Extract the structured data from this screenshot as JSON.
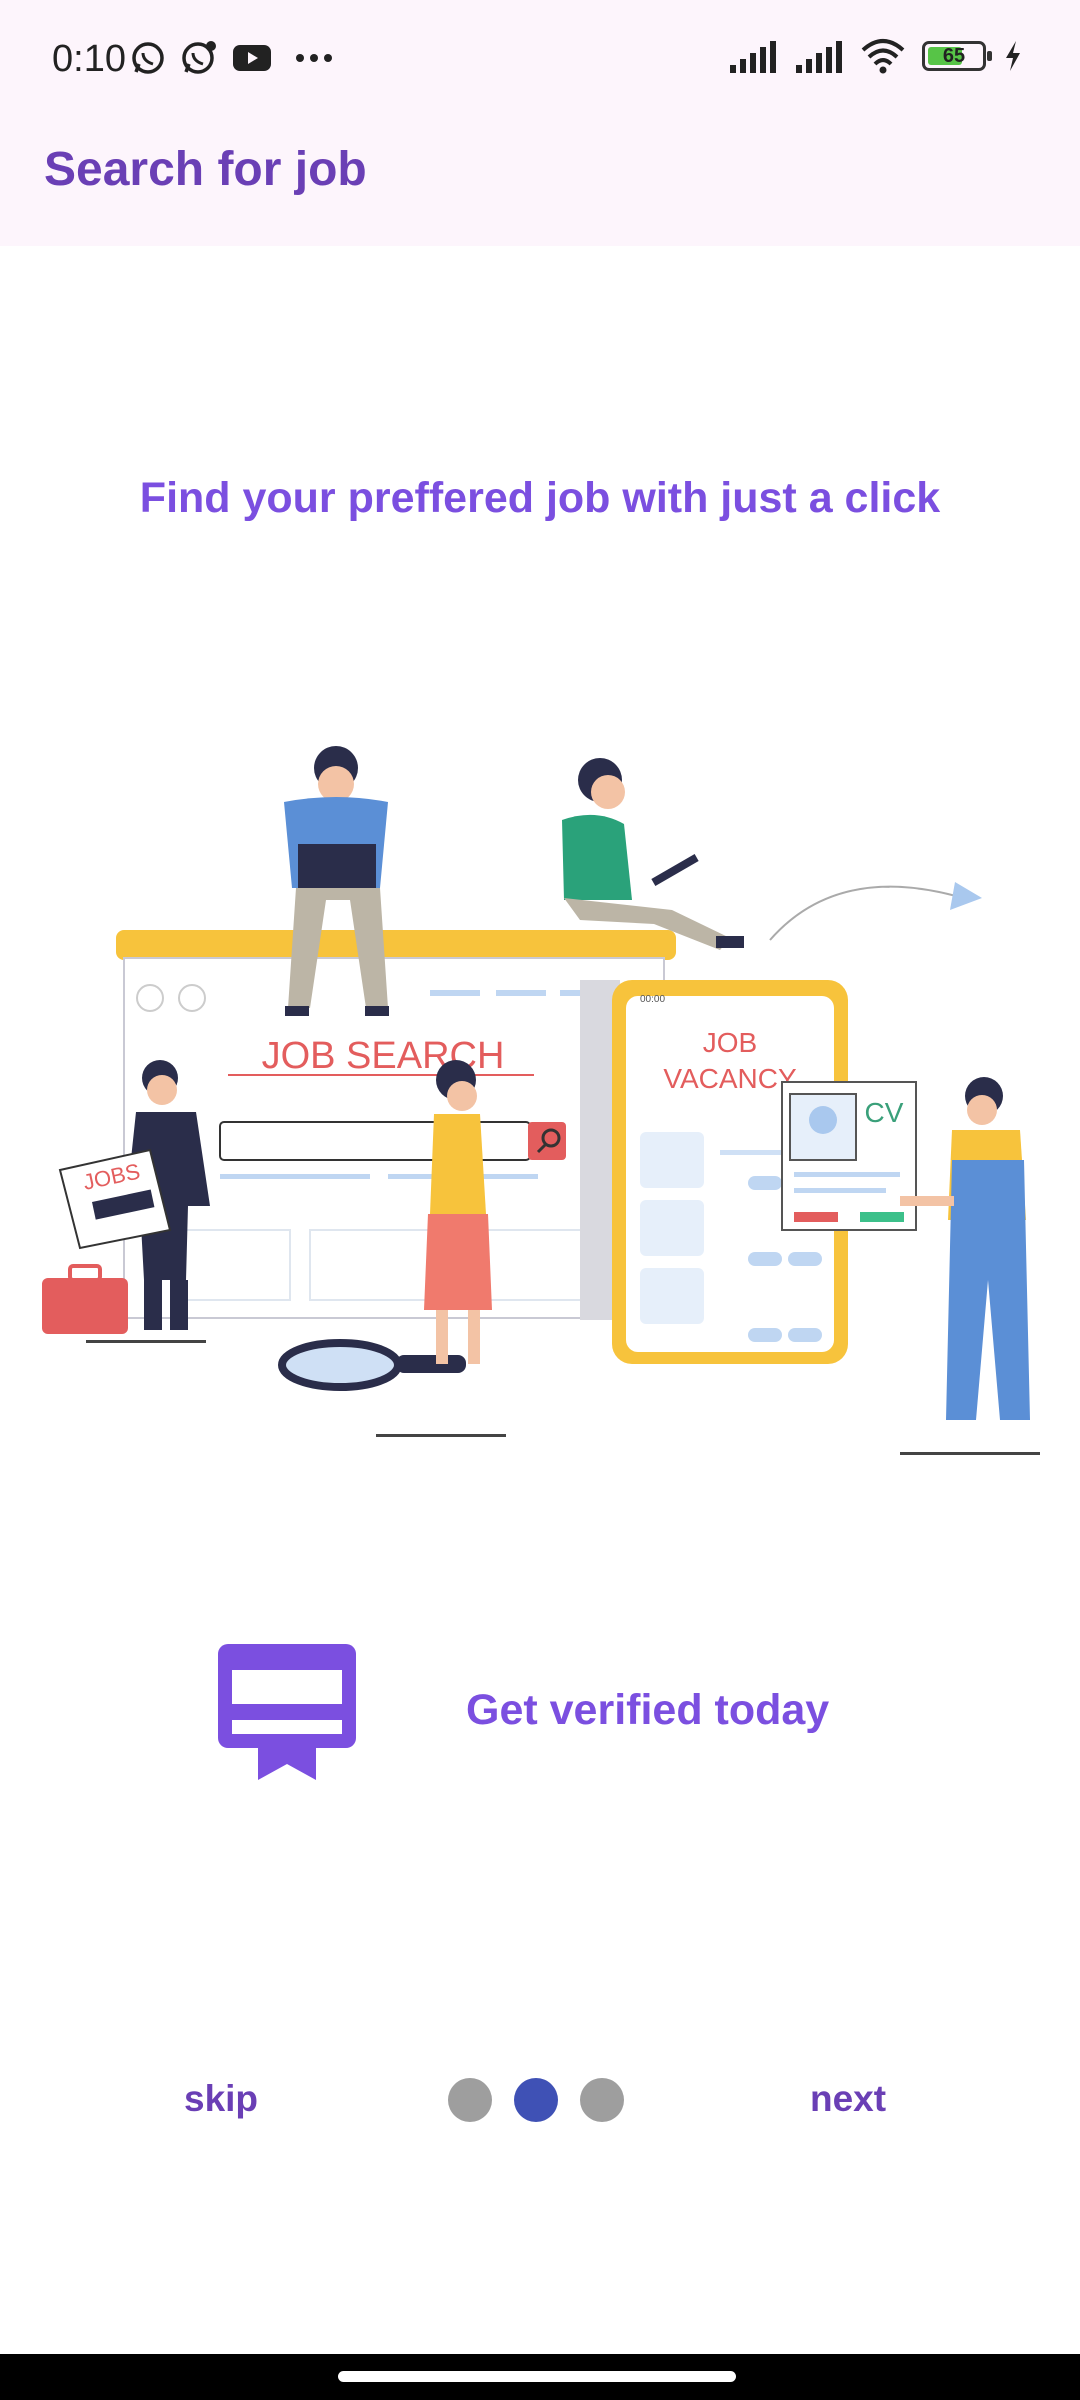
{
  "status_bar": {
    "time": "0:10",
    "icons": [
      "whatsapp-icon",
      "whatsapp-business-icon",
      "youtube-icon",
      "more-dots-icon",
      "signal-icon",
      "signal-icon",
      "wifi-icon",
      "battery-icon",
      "charging-icon"
    ],
    "battery_level": "65"
  },
  "app_bar": {
    "title": "Search for job"
  },
  "onboarding": {
    "headline": "Find your preffered job with just a click",
    "illustration_text": {
      "job_search": "JOB SEARCH",
      "job_vacancy_line1": "JOB",
      "job_vacancy_line2": "VACANCY",
      "cv": "CV",
      "jobs": "JOBS",
      "phone_time": "00:00"
    },
    "feature_text": "Get verified today",
    "page_index": 2,
    "page_count": 3
  },
  "navigation": {
    "skip_label": "skip",
    "next_label": "next"
  },
  "colors": {
    "accent": "#7b4fe0",
    "title": "#6a3fb5",
    "dot_active": "#3f51b5",
    "dot_inactive": "#9e9e9e",
    "app_bar_bg": "#fdf5fc"
  }
}
